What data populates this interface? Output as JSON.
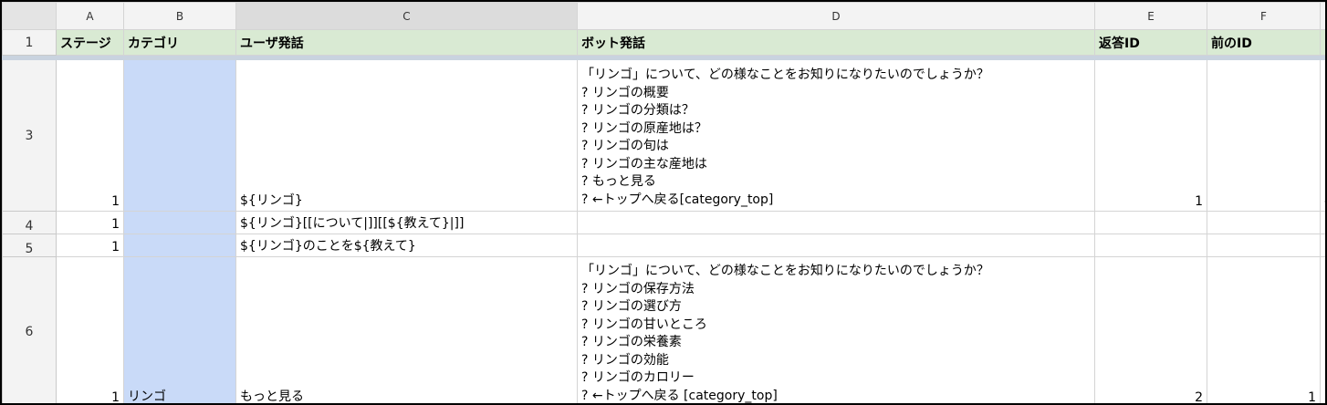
{
  "columns": [
    "A",
    "B",
    "C",
    "D",
    "E",
    "F"
  ],
  "header_row": {
    "num": "1",
    "cells": [
      "ステージ",
      "カテゴリ",
      "ユーザ発話",
      "ボット発話",
      "返答ID",
      "前のID"
    ]
  },
  "rows": [
    {
      "num": "3",
      "stage": "1",
      "category": "",
      "user_utterance": "${リンゴ}",
      "bot_utterance": "「リンゴ」について、どの様なことをお知りになりたいのでしょうか？\n? リンゴの概要\n? リンゴの分類は？\n? リンゴの原産地は？\n? リンゴの旬は\n? リンゴの主な産地は\n? もっと見る\n? ←トップへ戻る[category_top]",
      "response_id": "1",
      "prev_id": "",
      "overflow": "c"
    },
    {
      "num": "4",
      "stage": "1",
      "category": "",
      "user_utterance": "${リンゴ}[[について|]][[${教えて}|]]",
      "bot_utterance": "",
      "response_id": "",
      "prev_id": ""
    },
    {
      "num": "5",
      "stage": "1",
      "category": "",
      "user_utterance": "${リンゴ}のことを${教えて}",
      "bot_utterance": "",
      "response_id": "",
      "prev_id": ""
    },
    {
      "num": "6",
      "stage": "1",
      "category": "リンゴ",
      "user_utterance": "もっと見る",
      "bot_utterance": "「リンゴ」について、どの様なことをお知りになりたいのでしょうか？\n? リンゴの保存方法\n? リンゴの選び方\n? リンゴの甘いところ\n? リンゴの栄養素\n? リンゴの効能\n? リンゴのカロリー\n? ←トップへ戻る [category_top]",
      "response_id": "2",
      "prev_id": "1"
    }
  ],
  "colors": {
    "header_green": "#d9ead3",
    "category_blue": "#c9daf8",
    "grid": "#d4d4d4"
  }
}
